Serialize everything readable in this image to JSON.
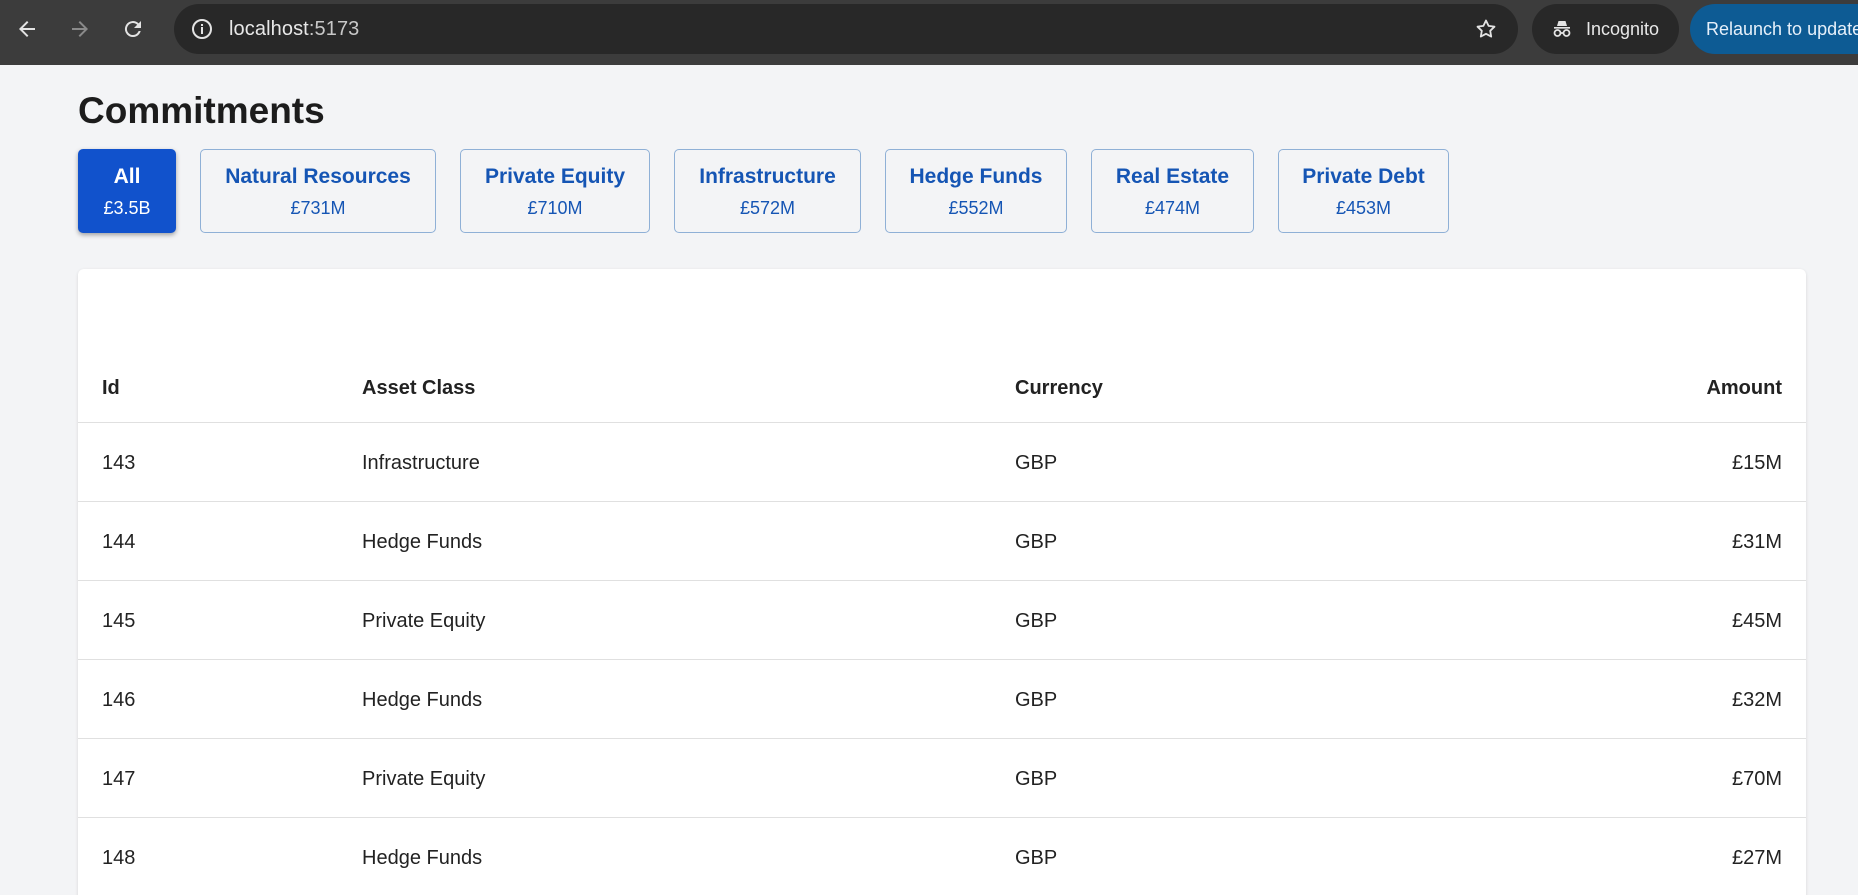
{
  "browser": {
    "url_host": "localhost",
    "url_port": ":5173",
    "incognito_label": "Incognito",
    "relaunch_label": "Relaunch to update"
  },
  "page": {
    "title": "Commitments"
  },
  "filters": [
    {
      "label": "All",
      "value": "£3.5B",
      "active": true
    },
    {
      "label": "Natural Resources",
      "value": "£731M",
      "active": false
    },
    {
      "label": "Private Equity",
      "value": "£710M",
      "active": false
    },
    {
      "label": "Infrastructure",
      "value": "£572M",
      "active": false
    },
    {
      "label": "Hedge Funds",
      "value": "£552M",
      "active": false
    },
    {
      "label": "Real Estate",
      "value": "£474M",
      "active": false
    },
    {
      "label": "Private Debt",
      "value": "£453M",
      "active": false
    }
  ],
  "table": {
    "headers": {
      "id": "Id",
      "asset_class": "Asset Class",
      "currency": "Currency",
      "amount": "Amount"
    },
    "rows": [
      {
        "id": "143",
        "asset_class": "Infrastructure",
        "currency": "GBP",
        "amount": "£15M"
      },
      {
        "id": "144",
        "asset_class": "Hedge Funds",
        "currency": "GBP",
        "amount": "£31M"
      },
      {
        "id": "145",
        "asset_class": "Private Equity",
        "currency": "GBP",
        "amount": "£45M"
      },
      {
        "id": "146",
        "asset_class": "Hedge Funds",
        "currency": "GBP",
        "amount": "£32M"
      },
      {
        "id": "147",
        "asset_class": "Private Equity",
        "currency": "GBP",
        "amount": "£70M"
      },
      {
        "id": "148",
        "asset_class": "Hedge Funds",
        "currency": "GBP",
        "amount": "£27M"
      }
    ]
  },
  "colors": {
    "accent": "#1152cc",
    "chip_text": "#1555b4",
    "page_bg": "#f3f4f6"
  }
}
